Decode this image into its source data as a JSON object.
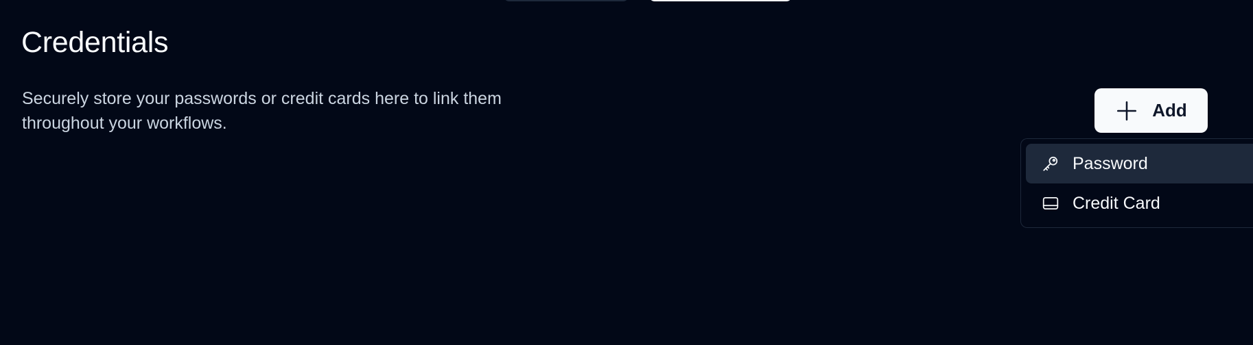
{
  "page": {
    "title": "Credentials",
    "description": "Securely store your passwords or credit cards here to link them throughout your workflows."
  },
  "add_button": {
    "label": "Add",
    "icon": "plus-icon"
  },
  "dropdown": {
    "items": [
      {
        "label": "Password",
        "icon": "key-icon",
        "highlighted": true
      },
      {
        "label": "Credit Card",
        "icon": "credit-card-icon",
        "highlighted": false
      }
    ]
  },
  "colors": {
    "background": "#020817",
    "text": "#f8fafc",
    "muted_text": "#cbd5e1",
    "button_bg": "#f8fafc",
    "button_text": "#0f172a",
    "menu_highlight": "#1e293b",
    "border": "#1e293b"
  }
}
